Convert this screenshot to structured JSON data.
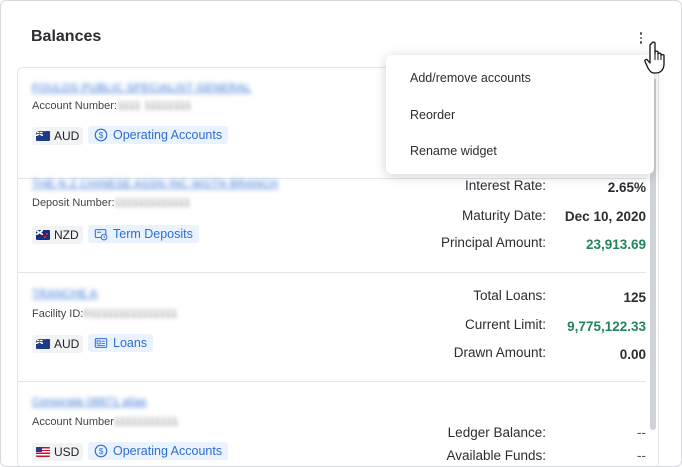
{
  "widget": {
    "title": "Balances",
    "menu": {
      "items": [
        {
          "label": "Add/remove accounts"
        },
        {
          "label": "Reorder"
        },
        {
          "label": "Rename widget"
        }
      ]
    }
  },
  "accounts": [
    {
      "name": "FOULDS PUBLIC SPECIALIST GENERAL",
      "number_label": "Account Number:",
      "number_masked": "1111 11111111",
      "currency": "AUD",
      "flag": "au",
      "type": "Operating Accounts",
      "type_icon": "dollar-circle-icon"
    },
    {
      "name": "THE N Z CHINESE ASSN INC WGTN BRANCH",
      "number_label": "Deposit Number:",
      "number_masked": "1111111111111",
      "currency": "NZD",
      "flag": "nz",
      "type": "Term Deposits",
      "type_icon": "term-deposit-icon",
      "details": [
        {
          "label": "Interest Rate:",
          "value": "2.65%"
        },
        {
          "label": "Maturity Date:",
          "value": "Dec 10, 2020"
        },
        {
          "label": "Principal Amount:",
          "value": "23,913.69"
        }
      ]
    },
    {
      "name": "TRANCHE A",
      "number_label": "Facility ID:",
      "number_masked": "0111111111111111",
      "currency": "AUD",
      "flag": "au",
      "type": "Loans",
      "type_icon": "loan-card-icon",
      "details": [
        {
          "label": "Total Loans:",
          "value": "125"
        },
        {
          "label": "Current Limit:",
          "value": "9,775,122.33"
        },
        {
          "label": "Drawn Amount:",
          "value": "0.00"
        }
      ]
    },
    {
      "name": "Corporate 08871 alias",
      "number_label": "Account Number",
      "number_masked": "11111111111",
      "currency": "USD",
      "flag": "us",
      "type": "Operating Accounts",
      "type_icon": "dollar-circle-icon",
      "details": [
        {
          "label": "Ledger Balance:",
          "value": "--"
        },
        {
          "label": "Available Funds:",
          "value": "--"
        }
      ]
    }
  ],
  "colors": {
    "accent": "#2d6fd1",
    "positive": "#23845a",
    "type_bg": "#eaf2fd"
  }
}
